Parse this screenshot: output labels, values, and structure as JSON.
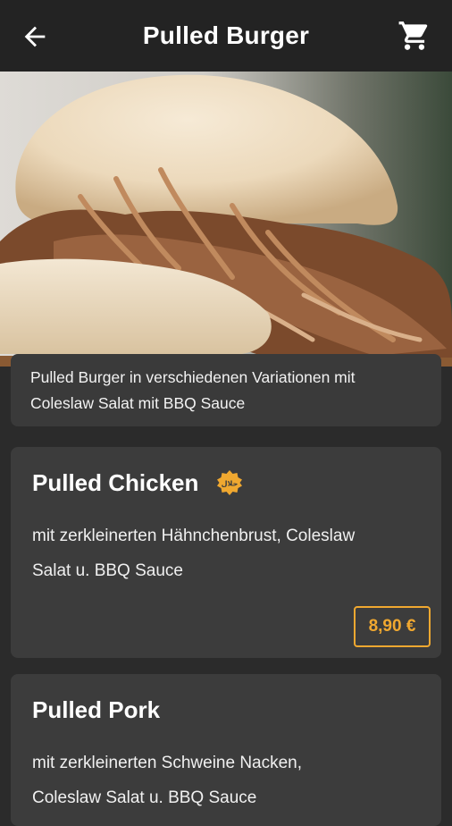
{
  "appbar": {
    "title": "Pulled Burger",
    "back_icon": "arrow-left-icon",
    "cart_icon": "shopping-cart-icon"
  },
  "category": {
    "description": "Pulled Burger in verschiedenen Variationen mit Coleslaw Salat mit BBQ Sauce"
  },
  "items": [
    {
      "name": "Pulled Chicken",
      "badge_icon": "halal-badge-icon",
      "description": "mit zerkleinerten Hähnchenbrust, Coleslaw Salat u. BBQ Sauce",
      "price": "8,90 €"
    },
    {
      "name": "Pulled Pork",
      "description": "mit zerkleinerten Schweine Nacken, Coleslaw Salat u. BBQ Sauce"
    }
  ],
  "colors": {
    "appbar": "#232323",
    "background": "#2b2b2b",
    "card": "#3c3c3c",
    "accent": "#f0a830"
  }
}
